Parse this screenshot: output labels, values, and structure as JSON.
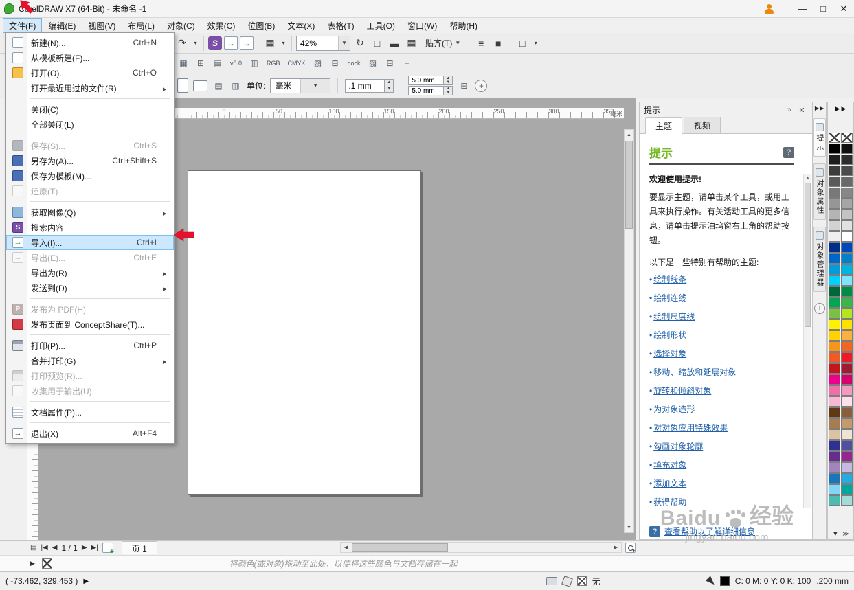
{
  "titlebar": {
    "title": "CorelDRAW X7 (64-Bit) - 未命名 -1"
  },
  "menubar": {
    "items": [
      {
        "label": "文件(F)",
        "active": true
      },
      {
        "label": "编辑(E)"
      },
      {
        "label": "视图(V)"
      },
      {
        "label": "布局(L)"
      },
      {
        "label": "对象(C)"
      },
      {
        "label": "效果(C)"
      },
      {
        "label": "位图(B)"
      },
      {
        "label": "文本(X)"
      },
      {
        "label": "表格(T)"
      },
      {
        "label": "工具(O)"
      },
      {
        "label": "窗口(W)"
      },
      {
        "label": "帮助(H)"
      }
    ]
  },
  "toolbar": {
    "zoom_value": "42%",
    "snap_label": "贴齐(T)",
    "group1": [
      {
        "name": "new-document-icon",
        "kind": "page"
      },
      {
        "name": "open-icon",
        "kind": "folder"
      },
      {
        "name": "save-icon",
        "kind": "floppy"
      },
      {
        "name": "print-icon",
        "kind": "printer"
      },
      {
        "separator": true
      },
      {
        "name": "cut-icon",
        "kind": "glyph",
        "glyph": "✂"
      },
      {
        "name": "copy-icon",
        "kind": "copy"
      },
      {
        "name": "paste-icon",
        "kind": "clipboard"
      },
      {
        "separator": true
      },
      {
        "name": "undo-icon",
        "kind": "glyph",
        "glyph": "↶"
      },
      {
        "name": "undo-dropdown-icon",
        "kind": "dd",
        "glyph": "▾"
      },
      {
        "name": "redo-icon",
        "kind": "glyph",
        "glyph": "↷"
      },
      {
        "name": "redo-dropdown-icon",
        "kind": "dd",
        "glyph": "▾"
      },
      {
        "separator": true
      },
      {
        "name": "search-content-icon",
        "kind": "search",
        "glyph": "S"
      },
      {
        "name": "import-icon",
        "kind": "imp",
        "glyph": "→"
      },
      {
        "name": "export-icon",
        "kind": "exp",
        "glyph": "→"
      },
      {
        "separator": true
      },
      {
        "name": "application-launcher-icon",
        "kind": "glyph",
        "glyph": "▦"
      },
      {
        "name": "launcher-dropdown-icon",
        "kind": "dd",
        "glyph": "▾"
      },
      {
        "separator": true
      }
    ],
    "group2": [
      {
        "name": "refresh-icon",
        "kind": "glyph",
        "glyph": "↻"
      },
      {
        "name": "fullscreen-preview-icon",
        "kind": "glyph",
        "glyph": "□"
      },
      {
        "name": "show-rulers-icon",
        "kind": "glyph",
        "glyph": "▬"
      },
      {
        "name": "show-grid-icon",
        "kind": "glyph",
        "glyph": "▦"
      }
    ],
    "group3": [
      {
        "separator": true
      },
      {
        "name": "options-icon",
        "kind": "glyph",
        "glyph": "≡"
      },
      {
        "name": "corel-account-icon",
        "kind": "glyph",
        "glyph": "■"
      },
      {
        "separator": true
      },
      {
        "name": "window-layout-icon",
        "kind": "glyph",
        "glyph": "□"
      },
      {
        "name": "window-layout-dropdown-icon",
        "kind": "dd",
        "glyph": "▾"
      }
    ]
  },
  "toolbar2": {
    "icons": [
      {
        "name": "navigator-icon",
        "glyph": "▦"
      },
      {
        "name": "snap-grid-icon",
        "glyph": "⊞"
      },
      {
        "name": "snap-guides-icon",
        "glyph": "▤"
      },
      {
        "name": "version-icon",
        "glyph": "v8.0",
        "txt": true
      },
      {
        "name": "distribute-icon",
        "glyph": "▥"
      },
      {
        "name": "rgb-profile-icon",
        "glyph": "RGB",
        "txt": true
      },
      {
        "name": "cmyk-profile-icon",
        "glyph": "CMYK",
        "txt": true
      },
      {
        "name": "page-setup-icon",
        "glyph": "▧"
      },
      {
        "name": "frame-icon",
        "glyph": "⊟"
      },
      {
        "name": "dock-icon",
        "glyph": "dock",
        "txt": true
      },
      {
        "name": "ruler-settings-icon",
        "glyph": "▨"
      },
      {
        "name": "grid-settings-icon",
        "glyph": "⊞"
      },
      {
        "name": "crosshair-icon",
        "glyph": "+"
      }
    ]
  },
  "propbar": {
    "units_label": "单位:",
    "units_value": "毫米",
    "nudge_value": ".1 mm",
    "dup_x": "5.0 mm",
    "dup_y": "5.0 mm"
  },
  "ruler": {
    "numbers": [
      "0",
      "50",
      "100",
      "150",
      "200",
      "250",
      "300",
      "350"
    ],
    "unit": "毫米"
  },
  "toolbox": {
    "tools": [
      {
        "name": "pick-tool"
      },
      {
        "name": "shape-tool"
      },
      {
        "name": "crop-tool"
      },
      {
        "name": "zoom-tool"
      },
      {
        "name": "freehand-tool"
      },
      {
        "name": "artistic-media-tool"
      },
      {
        "name": "rectangle-tool"
      },
      {
        "name": "ellipse-tool"
      },
      {
        "name": "polygon-tool"
      },
      {
        "name": "text-tool"
      },
      {
        "name": "table-tool"
      },
      {
        "name": "dimension-tool"
      },
      {
        "name": "connector-tool"
      },
      {
        "name": "drop-shadow-tool"
      },
      {
        "name": "transparency-tool"
      },
      {
        "name": "color-eyedropper-tool",
        "kind": "dropper"
      },
      {
        "name": "interactive-fill-tool",
        "kind": "colorful"
      },
      {
        "name": "smart-fill-tool"
      }
    ]
  },
  "file_menu": {
    "items": [
      {
        "label": "新建(N)...",
        "shortcut": "Ctrl+N",
        "icon": "new-document-icon"
      },
      {
        "label": "从模板新建(F)...",
        "icon": "new-from-template-icon"
      },
      {
        "label": "打开(O)...",
        "shortcut": "Ctrl+O",
        "icon": "open-folder-icon"
      },
      {
        "label": "打开最近用过的文件(R)",
        "submenu": true
      },
      {
        "separator": true
      },
      {
        "label": "关闭(C)"
      },
      {
        "label": "全部关闭(L)"
      },
      {
        "separator": true
      },
      {
        "label": "保存(S)...",
        "shortcut": "Ctrl+S",
        "disabled": true,
        "icon": "save-icon"
      },
      {
        "label": "另存为(A)...",
        "shortcut": "Ctrl+Shift+S",
        "icon": "save-as-icon"
      },
      {
        "label": "保存为模板(M)...",
        "icon": "save-template-icon"
      },
      {
        "label": "还原(T)",
        "disabled": true,
        "icon": "revert-icon"
      },
      {
        "separator": true
      },
      {
        "label": "获取图像(Q)",
        "submenu": true,
        "icon": "acquire-image-icon"
      },
      {
        "label": "搜索内容",
        "icon": "search-content-icon"
      },
      {
        "label": "导入(I)...",
        "shortcut": "Ctrl+I",
        "highlight": true,
        "icon": "import-icon"
      },
      {
        "label": "导出(E)...",
        "shortcut": "Ctrl+E",
        "disabled": true,
        "icon": "export-icon"
      },
      {
        "label": "导出为(R)",
        "submenu": true
      },
      {
        "label": "发送到(D)",
        "submenu": true
      },
      {
        "separator": true
      },
      {
        "label": "发布为 PDF(H)",
        "disabled": true,
        "icon": "pdf-icon"
      },
      {
        "label": "发布页面到 ConceptShare(T)...",
        "icon": "conceptshare-icon"
      },
      {
        "separator": true
      },
      {
        "label": "打印(P)...",
        "shortcut": "Ctrl+P",
        "icon": "print-icon"
      },
      {
        "label": "合并打印(G)",
        "submenu": true
      },
      {
        "label": "打印预览(R)...",
        "disabled": true,
        "icon": "print-preview-icon"
      },
      {
        "label": "收集用于输出(U)...",
        "disabled": true,
        "icon": "collect-output-icon"
      },
      {
        "separator": true
      },
      {
        "label": "文档属性(P)...",
        "icon": "document-properties-icon"
      },
      {
        "separator": true
      },
      {
        "label": "退出(X)",
        "shortcut": "Alt+F4",
        "icon": "exit-icon"
      }
    ]
  },
  "hints": {
    "docker_title": "提示",
    "tabs": [
      {
        "label": "主题",
        "active": true
      },
      {
        "label": "视频"
      }
    ],
    "heading": "提示",
    "welcome": "欢迎使用提示!",
    "intro": "要显示主题，请单击某个工具，或用工具来执行操作。有关活动工具的更多信息，请单击提示泊坞窗右上角的帮助按钮。",
    "topics_label": "以下是一些特别有帮助的主题:",
    "links": [
      {
        "label": "绘制线条"
      },
      {
        "label": "绘制连线"
      },
      {
        "label": "绘制尺度线"
      },
      {
        "label": "绘制形状"
      },
      {
        "label": "选择对象"
      },
      {
        "label": "移动、缩放和延展对象"
      },
      {
        "label": "旋转和倾斜对象"
      },
      {
        "label": "为对象造形"
      },
      {
        "label": "对对象应用特殊效果"
      },
      {
        "label": "勾画对象轮廓"
      },
      {
        "label": "填充对象"
      },
      {
        "label": "添加文本"
      },
      {
        "label": "获得帮助"
      }
    ],
    "more_help": "查看帮助以了解详细信息"
  },
  "side_tabs": {
    "items": [
      {
        "label": "提示",
        "active": true
      },
      {
        "label": "对象属性"
      },
      {
        "label": "对象管理器"
      }
    ]
  },
  "palette": {
    "colors": [
      {
        "nofill": true
      },
      {
        "nofill": true
      },
      {
        "color": "#000000"
      },
      {
        "color": "#0f0f0f"
      },
      {
        "color": "#1e1e1e"
      },
      {
        "color": "#2d2d2d"
      },
      {
        "color": "#3c3c3c"
      },
      {
        "color": "#4b4b4b"
      },
      {
        "color": "#5a5a5a"
      },
      {
        "color": "#696969"
      },
      {
        "color": "#787878"
      },
      {
        "color": "#878787"
      },
      {
        "color": "#969696"
      },
      {
        "color": "#a5a5a5"
      },
      {
        "color": "#b4b4b4"
      },
      {
        "color": "#c3c3c3"
      },
      {
        "color": "#d2d2d2"
      },
      {
        "color": "#e1e1e1"
      },
      {
        "color": "#f0f0f0"
      },
      {
        "color": "#ffffff"
      },
      {
        "color": "#002e8a"
      },
      {
        "color": "#0047bb"
      },
      {
        "color": "#0066cc"
      },
      {
        "color": "#0082ca"
      },
      {
        "color": "#009dd9"
      },
      {
        "color": "#00b5e2"
      },
      {
        "color": "#00cfff"
      },
      {
        "color": "#7fe5ff"
      },
      {
        "color": "#006838"
      },
      {
        "color": "#008c44"
      },
      {
        "color": "#00a651"
      },
      {
        "color": "#39b54a"
      },
      {
        "color": "#7ac143"
      },
      {
        "color": "#b5e61d"
      },
      {
        "color": "#fff200"
      },
      {
        "color": "#ffe100"
      },
      {
        "color": "#ffd200"
      },
      {
        "color": "#fcb040"
      },
      {
        "color": "#f7941d"
      },
      {
        "color": "#f26522"
      },
      {
        "color": "#f15a22"
      },
      {
        "color": "#ed1c24"
      },
      {
        "color": "#c4161c"
      },
      {
        "color": "#9e1b32"
      },
      {
        "color": "#ec008c"
      },
      {
        "color": "#d6006e"
      },
      {
        "color": "#f06eaa"
      },
      {
        "color": "#f49ac1"
      },
      {
        "color": "#f7b8d3"
      },
      {
        "color": "#fde0e9"
      },
      {
        "color": "#603913"
      },
      {
        "color": "#8a5d3b"
      },
      {
        "color": "#a97c50"
      },
      {
        "color": "#c49a6c"
      },
      {
        "color": "#dbc2a3"
      },
      {
        "color": "#efe3d3"
      },
      {
        "color": "#2e3192"
      },
      {
        "color": "#524fa1"
      },
      {
        "color": "#662d91"
      },
      {
        "color": "#92278f"
      },
      {
        "color": "#a186be"
      },
      {
        "color": "#c7b9e2"
      },
      {
        "color": "#1b75bc"
      },
      {
        "color": "#27aae1"
      },
      {
        "color": "#7fd6f7"
      },
      {
        "color": "#00a79d"
      },
      {
        "color": "#4cbcb3"
      },
      {
        "color": "#a3dcd6"
      }
    ]
  },
  "pagebar": {
    "page_indicator": "1 / 1",
    "page_tab": "页 1"
  },
  "docpalette_bar": {
    "hint": "将颜色(或对象)拖动至此处，以便将这些颜色与文档存储在一起"
  },
  "statusbar": {
    "coords": "( -73.462, 329.453 )",
    "fill_label": "无",
    "outline_info": "C: 0 M: 0 Y: 0 K: 100",
    "outline_width": ".200 mm"
  },
  "watermark": {
    "brand": "Baidu",
    "brand_cn": "经验",
    "url": "jingyan.baidu.com"
  },
  "colors": {
    "accent_green": "#76b82a",
    "highlight_blue": "#cce8ff",
    "arrow_red": "#e8112d"
  }
}
